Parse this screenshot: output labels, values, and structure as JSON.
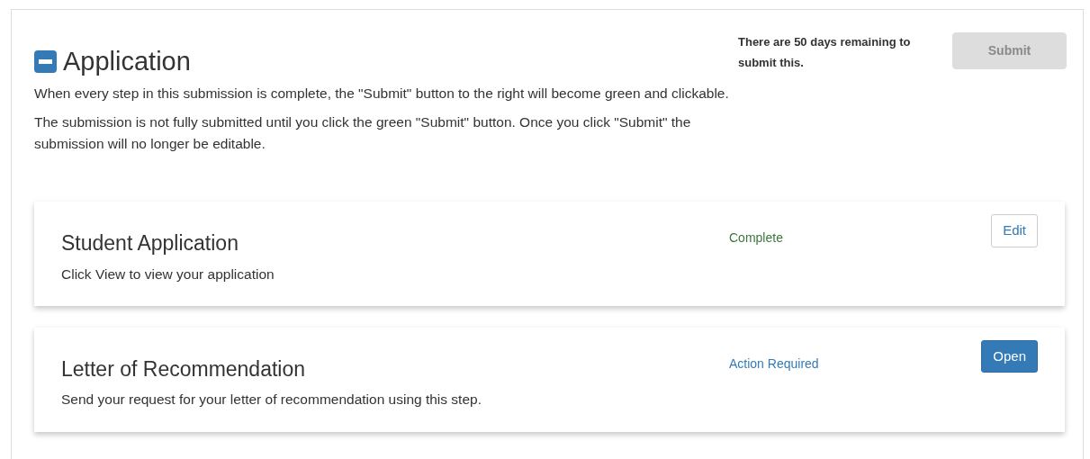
{
  "section": {
    "title": "Application",
    "expanded": true,
    "paragraphs": [
      "When every step in this submission is complete, the \"Submit\" button to the right will become green and clickable.",
      "The submission is not fully submitted until you click the green \"Submit\" button. Once you click \"Submit\" the submission will no longer be editable."
    ]
  },
  "deadline_notice": "There are 50 days remaining to submit this.",
  "submit_button": {
    "label": "Submit",
    "disabled": true
  },
  "steps": [
    {
      "title": "Student Application",
      "description": "Click View to view your application",
      "status": "Complete",
      "complete": true,
      "button": {
        "label": "Edit",
        "kind": "outline"
      }
    },
    {
      "title": "Letter of Recommendation",
      "description": "Send your request for your letter of recommendation using this step.",
      "status": "Action Required",
      "complete": false,
      "button": {
        "label": "Open",
        "kind": "primary"
      }
    }
  ]
}
